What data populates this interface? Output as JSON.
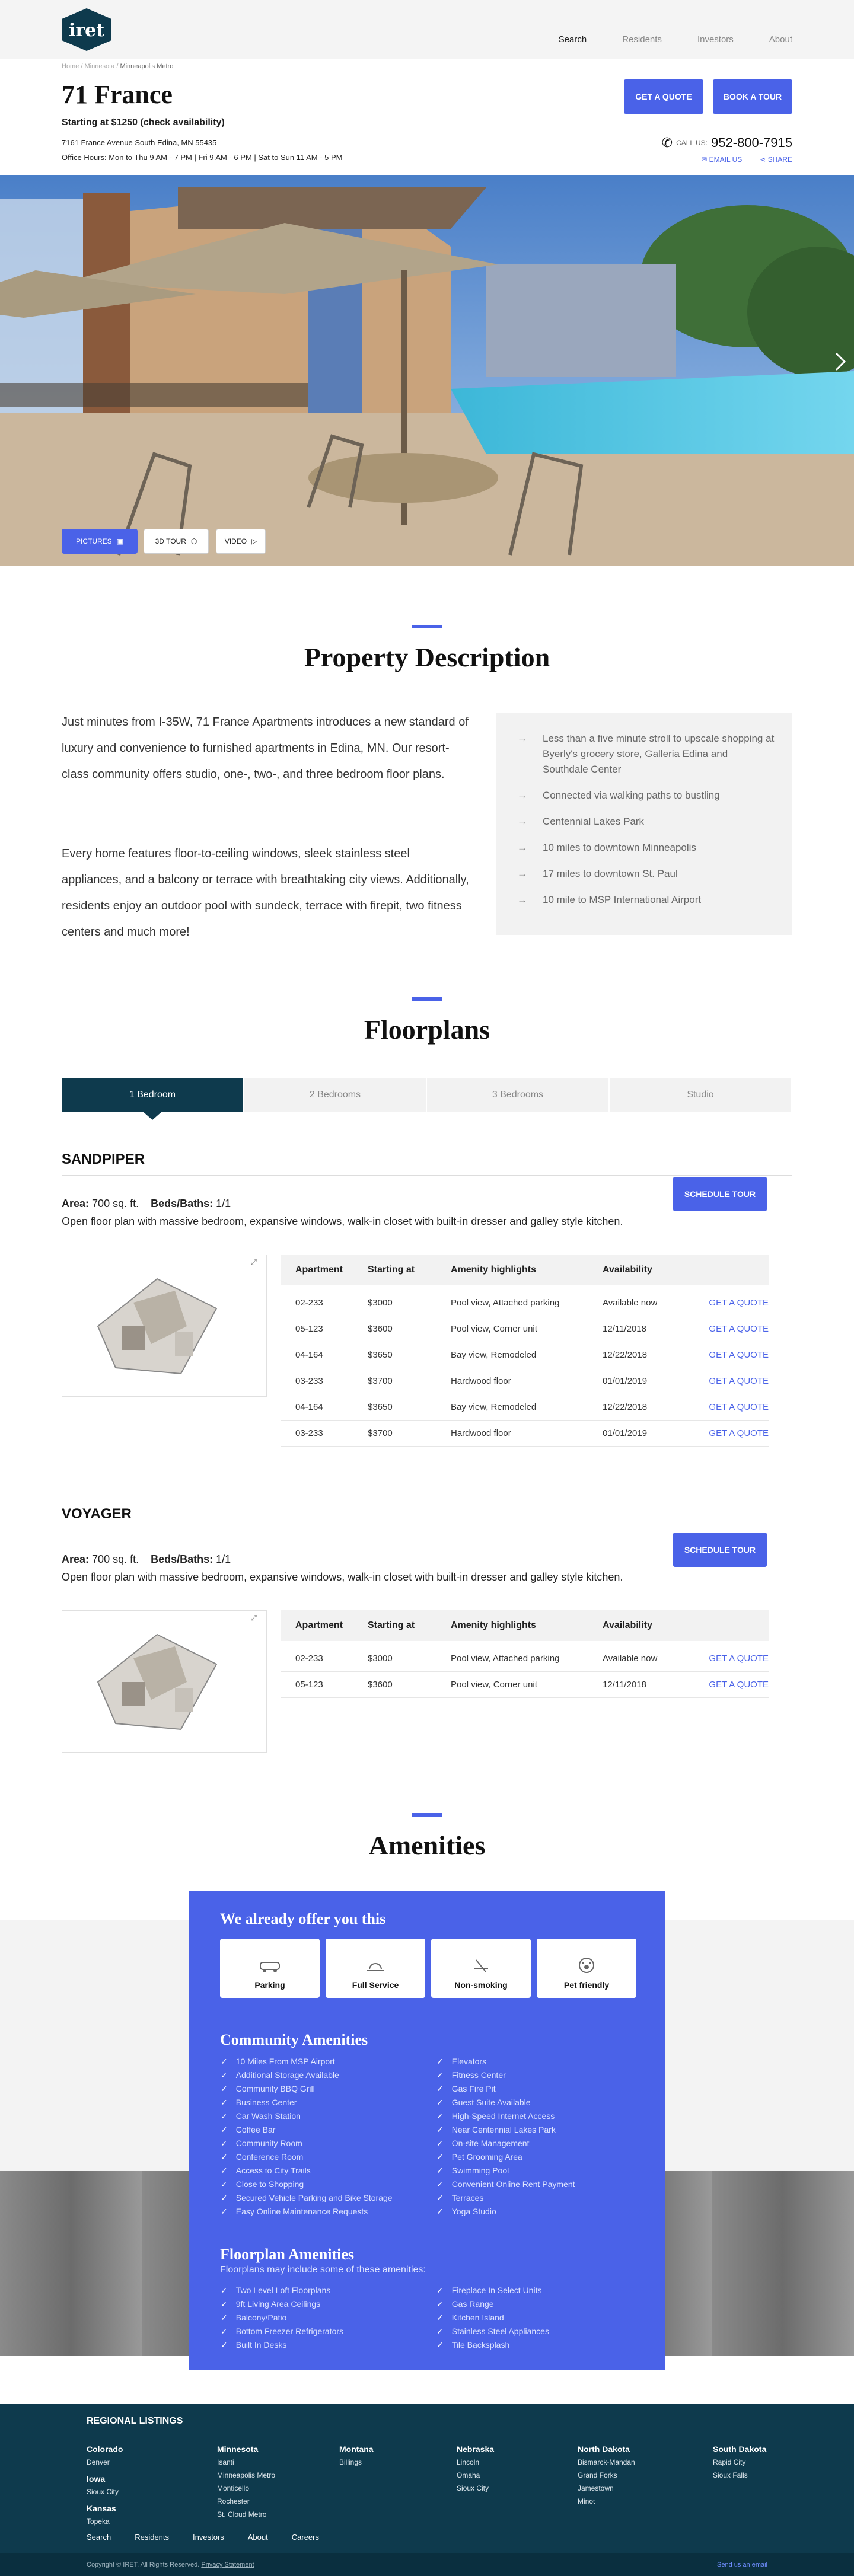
{
  "brand": {
    "logo_text": "iret",
    "accent": "#4a62e8",
    "dark": "#0e3a4d"
  },
  "nav": {
    "items": [
      "Search",
      "Residents",
      "Investors",
      "About"
    ]
  },
  "breadcrumb": [
    "Home",
    "Minnesota",
    "Minneapolis Metro"
  ],
  "property": {
    "title": "71 France",
    "starting": "Starting at $1250 (check availability)",
    "address": "7161 France Avenue South Edina, MN 55435",
    "hours": "Office Hours: Mon to Thu 9 AM - 7 PM  |  Fri 9 AM - 6 PM  |  Sat to Sun 11 AM - 5 PM",
    "get_quote": "GET A QUOTE",
    "book_tour": "BOOK A TOUR",
    "call_label": "CALL US:",
    "phone": "952-800-7915",
    "email_label": "EMAIL US",
    "share_label": "SHARE"
  },
  "media": {
    "pictures": "PICTURES",
    "tour3d": "3D TOUR",
    "video": "VIDEO"
  },
  "description": {
    "heading": "Property Description",
    "para1": "Just minutes from I-35W, 71 France Apartments introduces a new standard of luxury and convenience to furnished apartments in Edina, MN.  Our resort-class community offers studio, one-, two-, and three bedroom floor plans.",
    "para2": "Every home features floor-to-ceiling windows, sleek stainless steel appliances, and a balcony or terrace with breathtaking city views. Additionally, residents enjoy an outdoor pool with sundeck, terrace with firepit, two fitness centers and much more!",
    "highlights": [
      "Less than a five minute stroll to upscale shopping at Byerly's grocery store, Galleria Edina and Southdale Center",
      "Connected via walking paths to bustling",
      "Centennial Lakes Park",
      "10 miles to downtown Minneapolis",
      "17 miles to downtown St. Paul",
      "10 mile to MSP International Airport"
    ]
  },
  "floorplans": {
    "heading": "Floorplans",
    "tabs": [
      "1 Bedroom",
      "2 Bedrooms",
      "3 Bedrooms",
      "Studio"
    ],
    "table_headers": [
      "Apartment",
      "Starting at",
      "Amenity highlights",
      "Availability"
    ],
    "schedule_tour": "SCHEDULE TOUR",
    "plans": [
      {
        "name": "SANDPIPER",
        "area_label": "Area:",
        "area": "700 sq. ft.",
        "beds_label": "Beds/Baths:",
        "beds": "1/1",
        "desc": "Open floor plan with massive bedroom, expansive windows, walk-in closet with built-in dresser and galley style kitchen.",
        "rows": [
          {
            "apt": "02-233",
            "price": "$3000",
            "amenity": "Pool view, Attached parking",
            "avail": "Available now",
            "cta": "GET A QUOTE"
          },
          {
            "apt": "05-123",
            "price": "$3600",
            "amenity": "Pool view, Corner unit",
            "avail": "12/11/2018",
            "cta": "GET A QUOTE"
          },
          {
            "apt": "04-164",
            "price": "$3650",
            "amenity": "Bay view, Remodeled",
            "avail": "12/22/2018",
            "cta": "GET A QUOTE"
          },
          {
            "apt": "03-233",
            "price": "$3700",
            "amenity": "Hardwood floor",
            "avail": "01/01/2019",
            "cta": "GET A QUOTE"
          },
          {
            "apt": "04-164",
            "price": "$3650",
            "amenity": "Bay view, Remodeled",
            "avail": "12/22/2018",
            "cta": "GET A QUOTE"
          },
          {
            "apt": "03-233",
            "price": "$3700",
            "amenity": "Hardwood floor",
            "avail": "01/01/2019",
            "cta": "GET A QUOTE"
          }
        ]
      },
      {
        "name": "VOYAGER",
        "area_label": "Area:",
        "area": "700 sq. ft.",
        "beds_label": "Beds/Baths:",
        "beds": "1/1",
        "desc": "Open floor plan with massive bedroom, expansive windows, walk-in closet with built-in dresser and galley style kitchen.",
        "rows": [
          {
            "apt": "02-233",
            "price": "$3000",
            "amenity": "Pool view, Attached parking",
            "avail": "Available now",
            "cta": "GET A QUOTE"
          },
          {
            "apt": "05-123",
            "price": "$3600",
            "amenity": "Pool view, Corner unit",
            "avail": "12/11/2018",
            "cta": "GET A QUOTE"
          }
        ]
      }
    ]
  },
  "amenities": {
    "heading": "Amenities",
    "offer_title": "We already offer you this",
    "offers": [
      "Parking",
      "Full Service",
      "Non-smoking",
      "Pet friendly"
    ],
    "community_title": "Community Amenities",
    "community_left": [
      "10 Miles From MSP Airport",
      "Additional Storage Available",
      "Community BBQ Grill",
      "Business Center",
      "Car Wash Station",
      "Coffee Bar",
      "Community Room",
      "Conference Room",
      "Access to City Trails",
      "Close to Shopping",
      "Secured Vehicle Parking and Bike Storage",
      "Easy Online Maintenance Requests"
    ],
    "community_right": [
      "Elevators",
      "Fitness Center",
      "Gas Fire Pit",
      "Guest Suite Available",
      "High-Speed Internet Access",
      "Near Centennial Lakes Park",
      "On-site Management",
      "Pet Grooming Area",
      "Swimming Pool",
      "Convenient Online Rent Payment",
      "Terraces",
      "Yoga Studio"
    ],
    "fp_title": "Floorplan Amenities",
    "fp_sub": "Floorplans may include some of these amenities:",
    "fp_left": [
      "Two Level Loft Floorplans",
      "9ft Living Area Ceilings",
      "Balcony/Patio",
      "Bottom Freezer Refrigerators",
      "Built In Desks"
    ],
    "fp_right": [
      "Fireplace In Select Units",
      "Gas Range",
      "Kitchen Island",
      "Stainless Steel Appliances",
      "Tile Backsplash"
    ]
  },
  "footer": {
    "title": "REGIONAL LISTINGS",
    "cols": [
      {
        "groups": [
          {
            "state": "Colorado",
            "cities": [
              "Denver"
            ]
          },
          {
            "state": "Iowa",
            "cities": [
              "Sioux City"
            ]
          },
          {
            "state": "Kansas",
            "cities": [
              "Topeka"
            ]
          }
        ]
      },
      {
        "groups": [
          {
            "state": "Minnesota",
            "cities": [
              "Isanti",
              "Minneapolis Metro",
              "Monticello",
              "Rochester",
              "St. Cloud Metro"
            ]
          }
        ]
      },
      {
        "groups": [
          {
            "state": "Montana",
            "cities": [
              "Billings"
            ]
          }
        ]
      },
      {
        "groups": [
          {
            "state": "Nebraska",
            "cities": [
              "Lincoln",
              "Omaha",
              "Sioux City"
            ]
          }
        ]
      },
      {
        "groups": [
          {
            "state": "North Dakota",
            "cities": [
              "Bismarck-Mandan",
              "Grand Forks",
              "Jamestown",
              "Minot"
            ]
          }
        ]
      },
      {
        "groups": [
          {
            "state": "South Dakota",
            "cities": [
              "Rapid City",
              "Sioux Falls"
            ]
          }
        ]
      }
    ],
    "nav": [
      "Search",
      "Residents",
      "Investors",
      "About",
      "Careers"
    ],
    "copyright": "Copyright © IRET. All Rights Reserved.",
    "privacy": "Privacy Statement",
    "send_email": "Send us an email"
  }
}
